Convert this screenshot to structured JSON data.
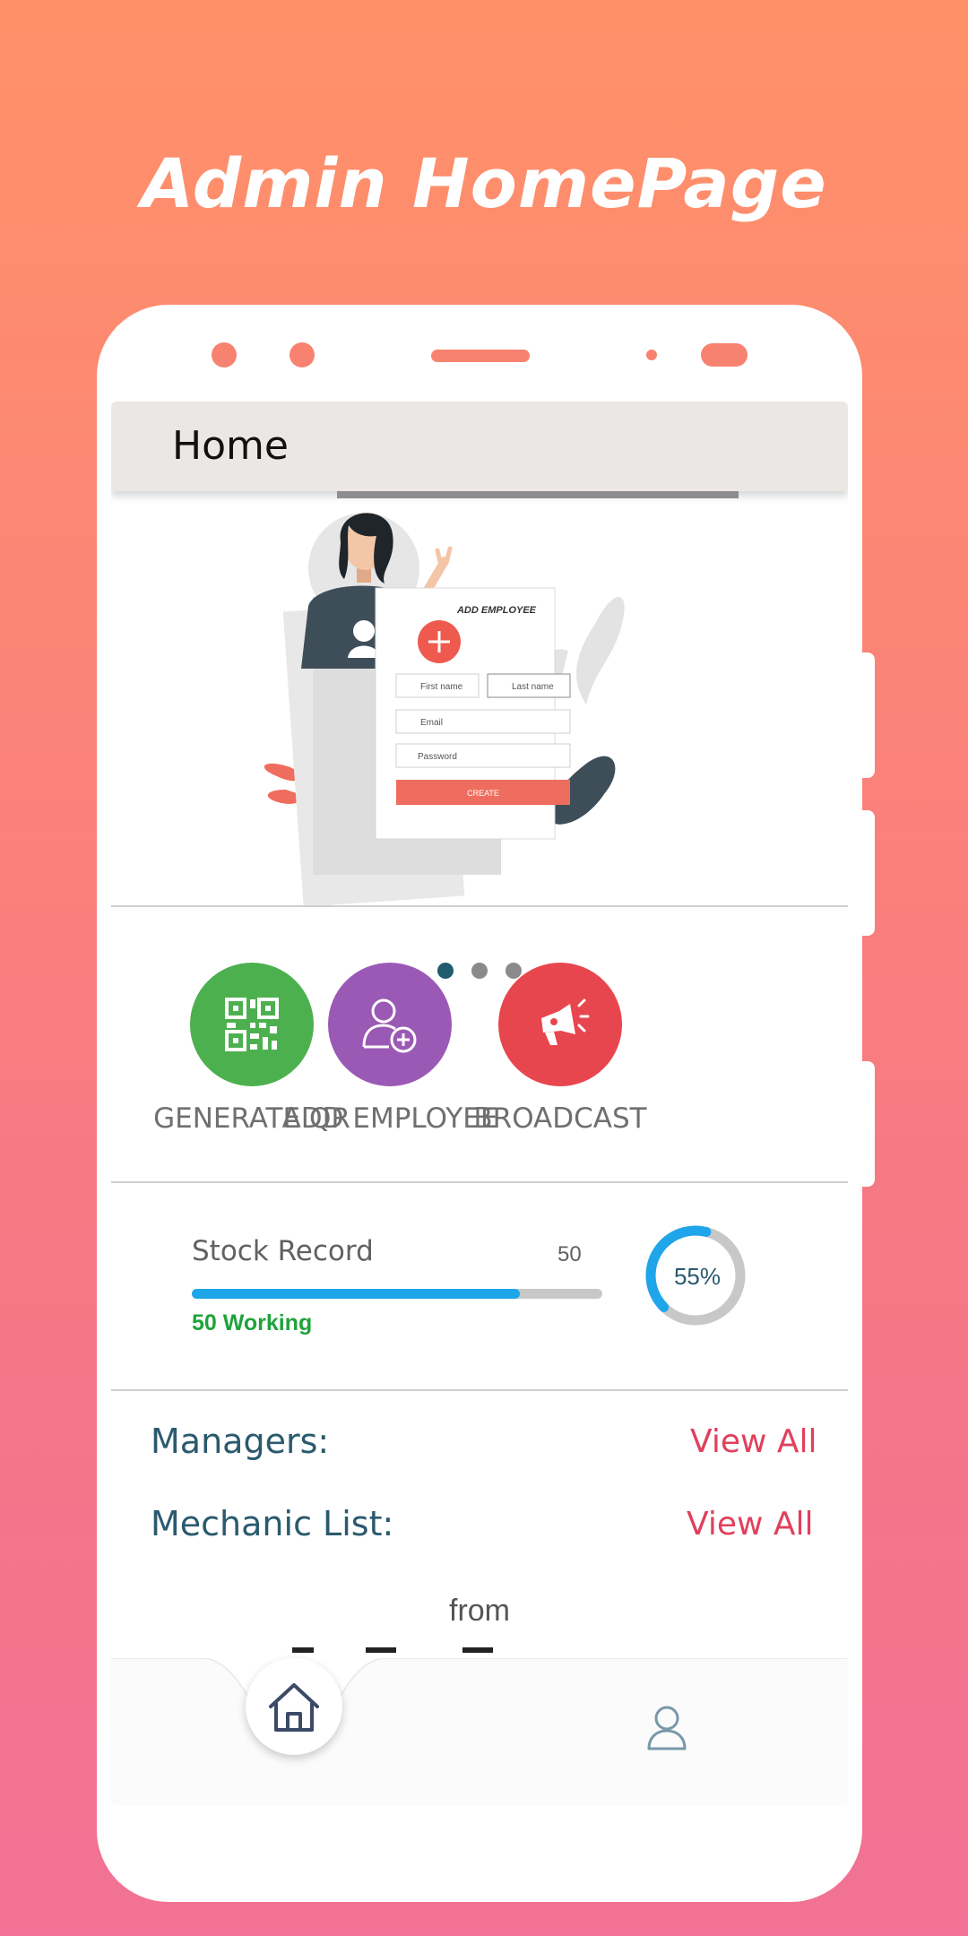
{
  "hero": {
    "title": "Admin HomePage"
  },
  "appbar": {
    "title": "Home"
  },
  "banner": {
    "form_title": "ADD EMPLOYEE",
    "first_name": "First name",
    "last_name": "Last name",
    "email": "Email",
    "password": "Password",
    "create": "CREATE",
    "active_slide": 1,
    "slide_count": 3
  },
  "actions": [
    {
      "label": "GENERATE QR",
      "icon": "qr-code-icon",
      "color": "#4db04f"
    },
    {
      "label": "ADD EMPLOYEE",
      "icon": "add-user-icon",
      "color": "#9b59b6"
    },
    {
      "label": "BROADCAST",
      "icon": "megaphone-icon",
      "color": "#e8464e"
    }
  ],
  "stock": {
    "title": "Stock Record",
    "count": "50",
    "working": "50 Working",
    "progress_fraction": 0.8,
    "ring_percent": "55%",
    "ring_fraction": 0.55
  },
  "links": {
    "managers_label": "Managers:",
    "managers_action": "View All",
    "mechanic_label": "Mechanic List:",
    "mechanic_action": "View All"
  },
  "footer": {
    "from": "from"
  },
  "colors": {
    "accent": "#f88270",
    "progress": "#1ea5ea",
    "link": "#e0405c",
    "heading": "#2a5a6e",
    "working": "#1fa33a"
  }
}
